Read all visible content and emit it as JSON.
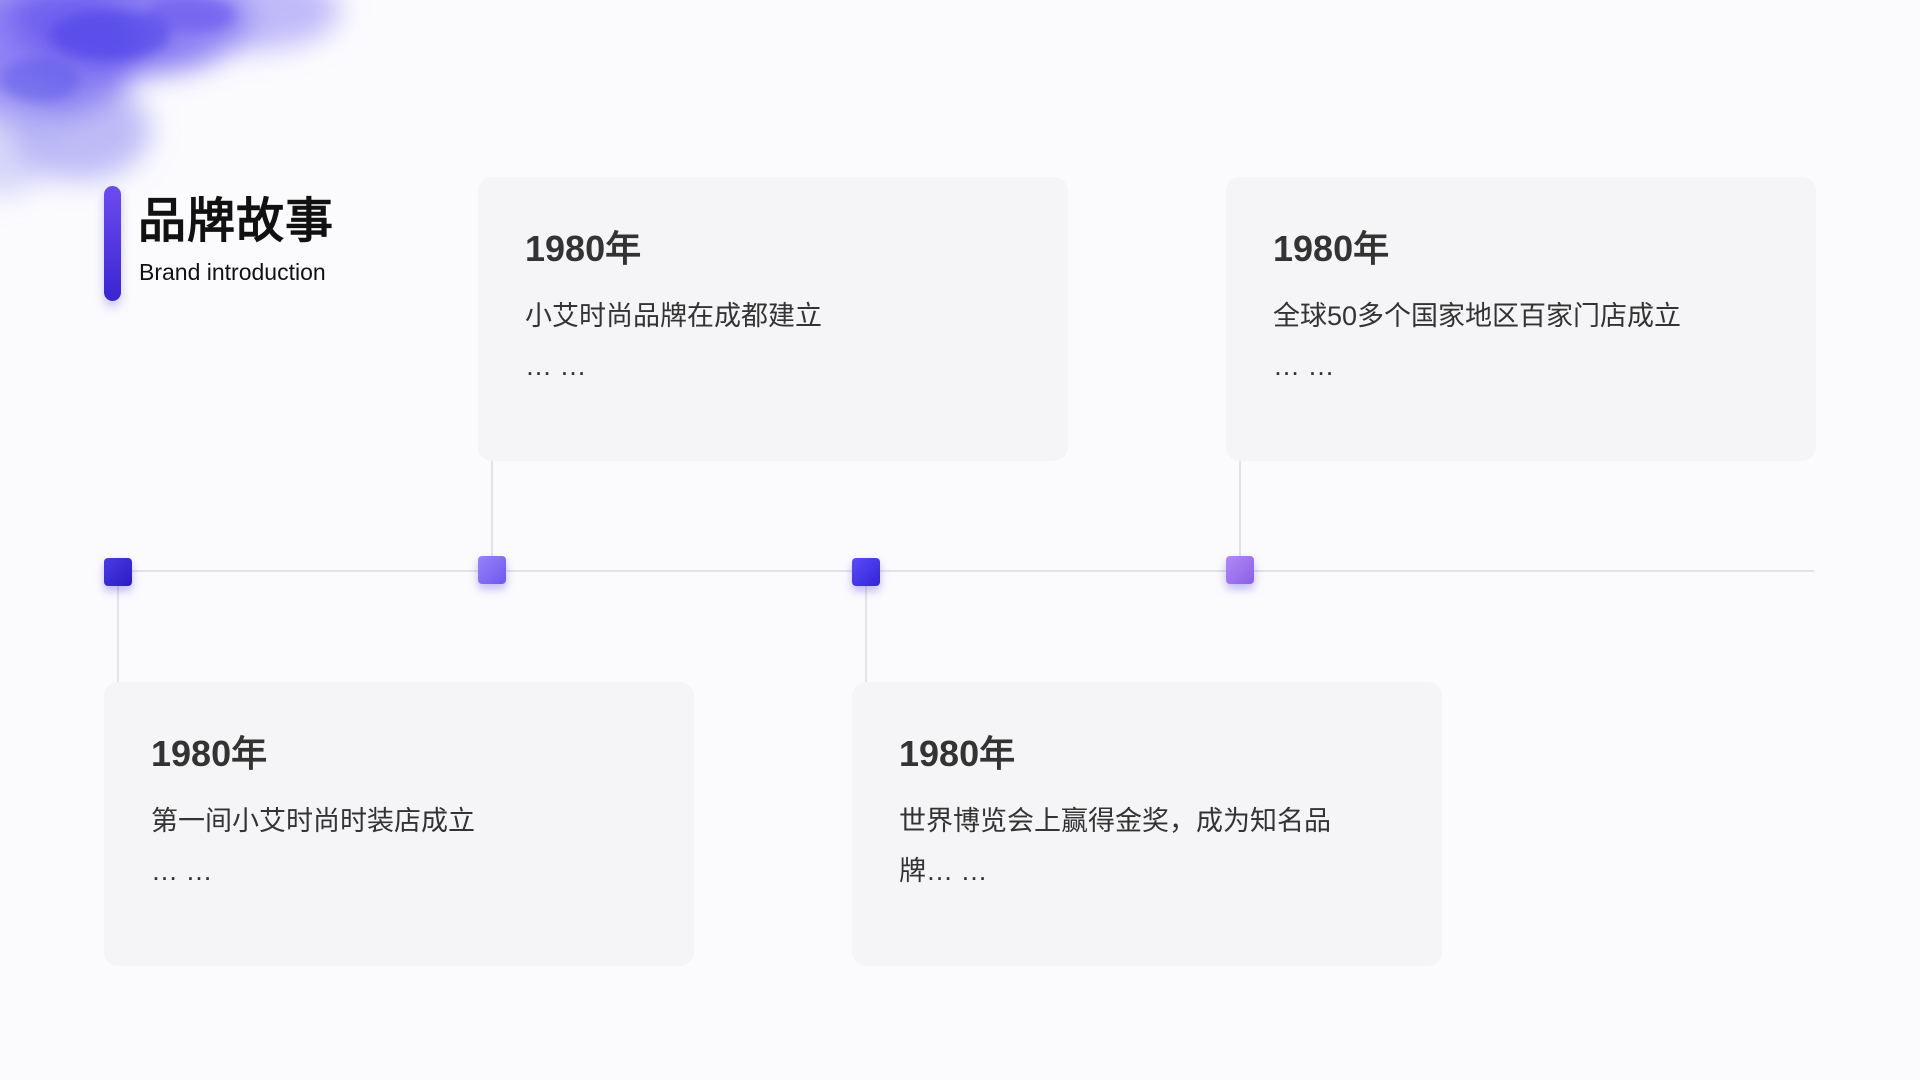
{
  "header": {
    "title": "品牌故事",
    "subtitle": "Brand introduction"
  },
  "timeline": {
    "events": [
      {
        "year": "1980年",
        "description": "第一间小艾时尚时装店成立",
        "ellipsis": "… …"
      },
      {
        "year": "1980年",
        "description": "小艾时尚品牌在成都建立",
        "ellipsis": "… …"
      },
      {
        "year": "1980年",
        "description": "世界博览会上赢得金奖，成为知名品牌… …",
        "ellipsis": ""
      },
      {
        "year": "1980年",
        "description": "全球50多个国家地区百家门店成立",
        "ellipsis": "… …"
      }
    ]
  },
  "colors": {
    "background": "#fbfbfe",
    "card": "#f5f5f7",
    "accent_dark": "#3a25d0",
    "accent_mid": "#4b3cf0",
    "accent_light": "#8a6cf5",
    "accent_violet": "#a06cf0",
    "line": "#e2e2e8",
    "text": "#333333"
  }
}
